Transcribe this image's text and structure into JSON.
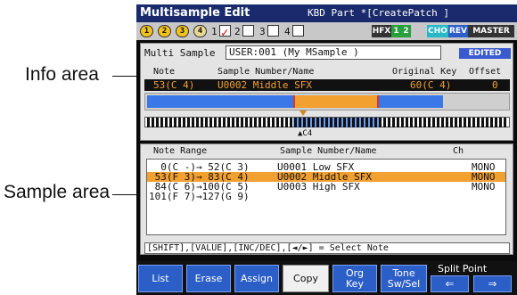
{
  "callouts": {
    "info": "Info area",
    "sample": "Sample area"
  },
  "title": {
    "screen": "Multisample Edit",
    "context": "KBD Part *[CreatePatch ]"
  },
  "status": {
    "circles": [
      "1",
      "2",
      "3",
      "4"
    ],
    "parts": [
      "1",
      "2",
      "3",
      "4"
    ],
    "tags": [
      "HFX",
      "1",
      "2",
      "CHO",
      "REV",
      "MASTER"
    ]
  },
  "info": {
    "ms_label": "Multi Sample",
    "ms_value": "USER:001  (My MSample    )",
    "edited": "EDITED",
    "headers": {
      "note": "Note",
      "sample": "Sample Number/Name",
      "origkey": "Original Key",
      "offset": "Offset"
    },
    "selected": {
      "note": "53(C 4)",
      "sample": "U0002 Middle SFX",
      "origkey": "60(C 4)",
      "offset": "0"
    },
    "key_label": "C4"
  },
  "samples": {
    "headers": {
      "range": "Note Range",
      "name": "Sample Number/Name",
      "ch": "Ch"
    },
    "rows": [
      {
        "range": "  0(C -)→ 52(C 3)",
        "name": "U0001 Low SFX",
        "ch": "MONO"
      },
      {
        "range": " 53(F 3)→ 83(C 4)",
        "name": "U0002 Middle SFX",
        "ch": "MONO"
      },
      {
        "range": " 84(C 6)→100(C 5)",
        "name": "U0003 High SFX",
        "ch": "MONO"
      },
      {
        "range": "101(F 7)→127(G 9)",
        "name": "",
        "ch": ""
      }
    ],
    "hint": "[SHIFT],[VALUE],[INC/DEC],[◄/►] = Select Note"
  },
  "buttons": {
    "list": "List",
    "erase": "Erase",
    "assign": "Assign",
    "copy": "Copy",
    "orgkey1": "Org",
    "orgkey2": "Key",
    "tone1": "Tone",
    "tone2": "Sw/Sel",
    "split": "Split Point",
    "left_icon": "arrow-left-icon",
    "right_icon": "arrow-right-icon"
  },
  "colors": {
    "accent": "#2c5ec8",
    "highlight": "#f2a030",
    "titlebar": "#1a2b6d"
  }
}
